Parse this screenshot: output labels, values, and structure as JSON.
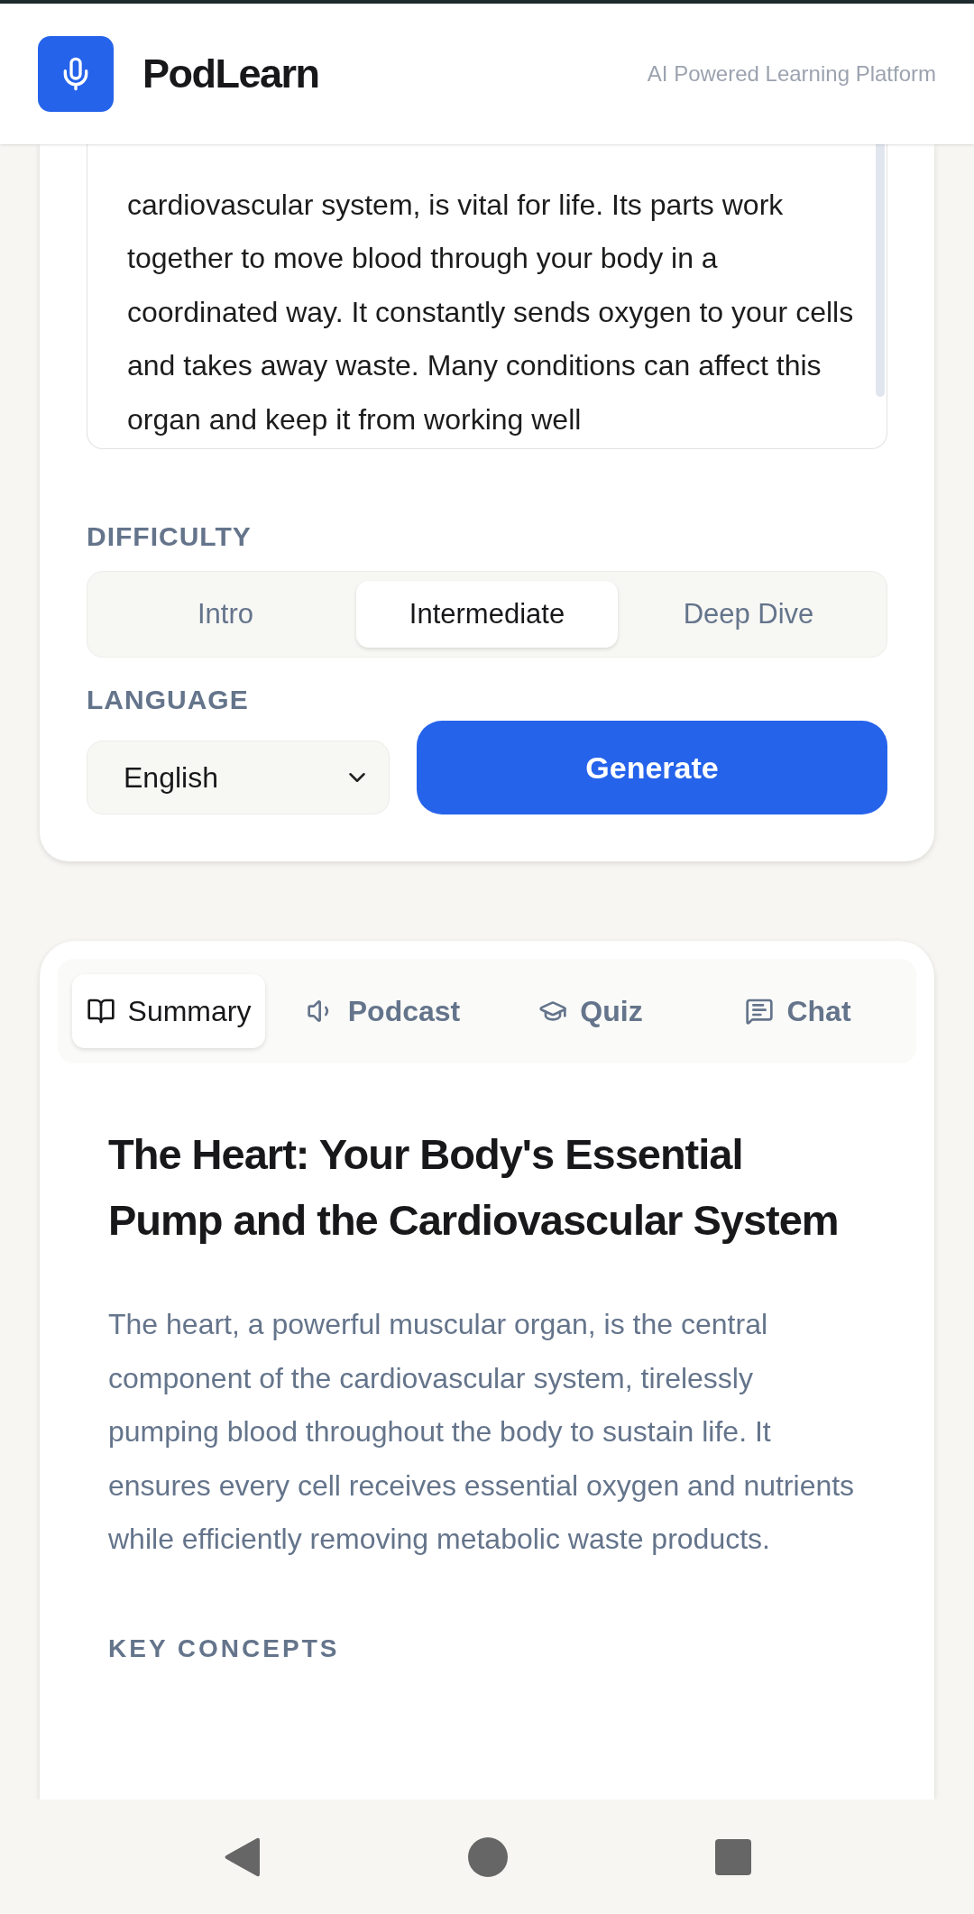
{
  "header": {
    "app_name": "PodLearn",
    "tagline": "AI Powered Learning Platform"
  },
  "input_card": {
    "topic_text": "cardiovascular system, is vital for life. Its parts work together to move blood through your body in a coordinated way. It constantly sends oxygen to your cells and takes away waste. Many conditions can affect this organ and keep it from working well",
    "difficulty_label": "DIFFICULTY",
    "difficulty_options": [
      {
        "label": "Intro",
        "selected": false
      },
      {
        "label": "Intermediate",
        "selected": true
      },
      {
        "label": "Deep Dive",
        "selected": false
      }
    ],
    "language_label": "LANGUAGE",
    "language_value": "English",
    "generate_button": "Generate"
  },
  "result_card": {
    "tabs": [
      {
        "kind": "summary",
        "label": "Summary",
        "selected": true
      },
      {
        "kind": "podcast",
        "label": "Podcast",
        "selected": false
      },
      {
        "kind": "quiz",
        "label": "Quiz",
        "selected": false
      },
      {
        "kind": "chat",
        "label": "Chat",
        "selected": false
      }
    ],
    "title": "The Heart: Your Body's Essential Pump and the Cardiovascular System",
    "summary": "The heart, a powerful muscular organ, is the central component of the cardiovascular system, tirelessly pumping blood throughout the body to sustain life. It ensures every cell receives essential oxygen and nutrients while efficiently removing metabolic waste products.",
    "section_heading": "KEY CONCEPTS"
  }
}
